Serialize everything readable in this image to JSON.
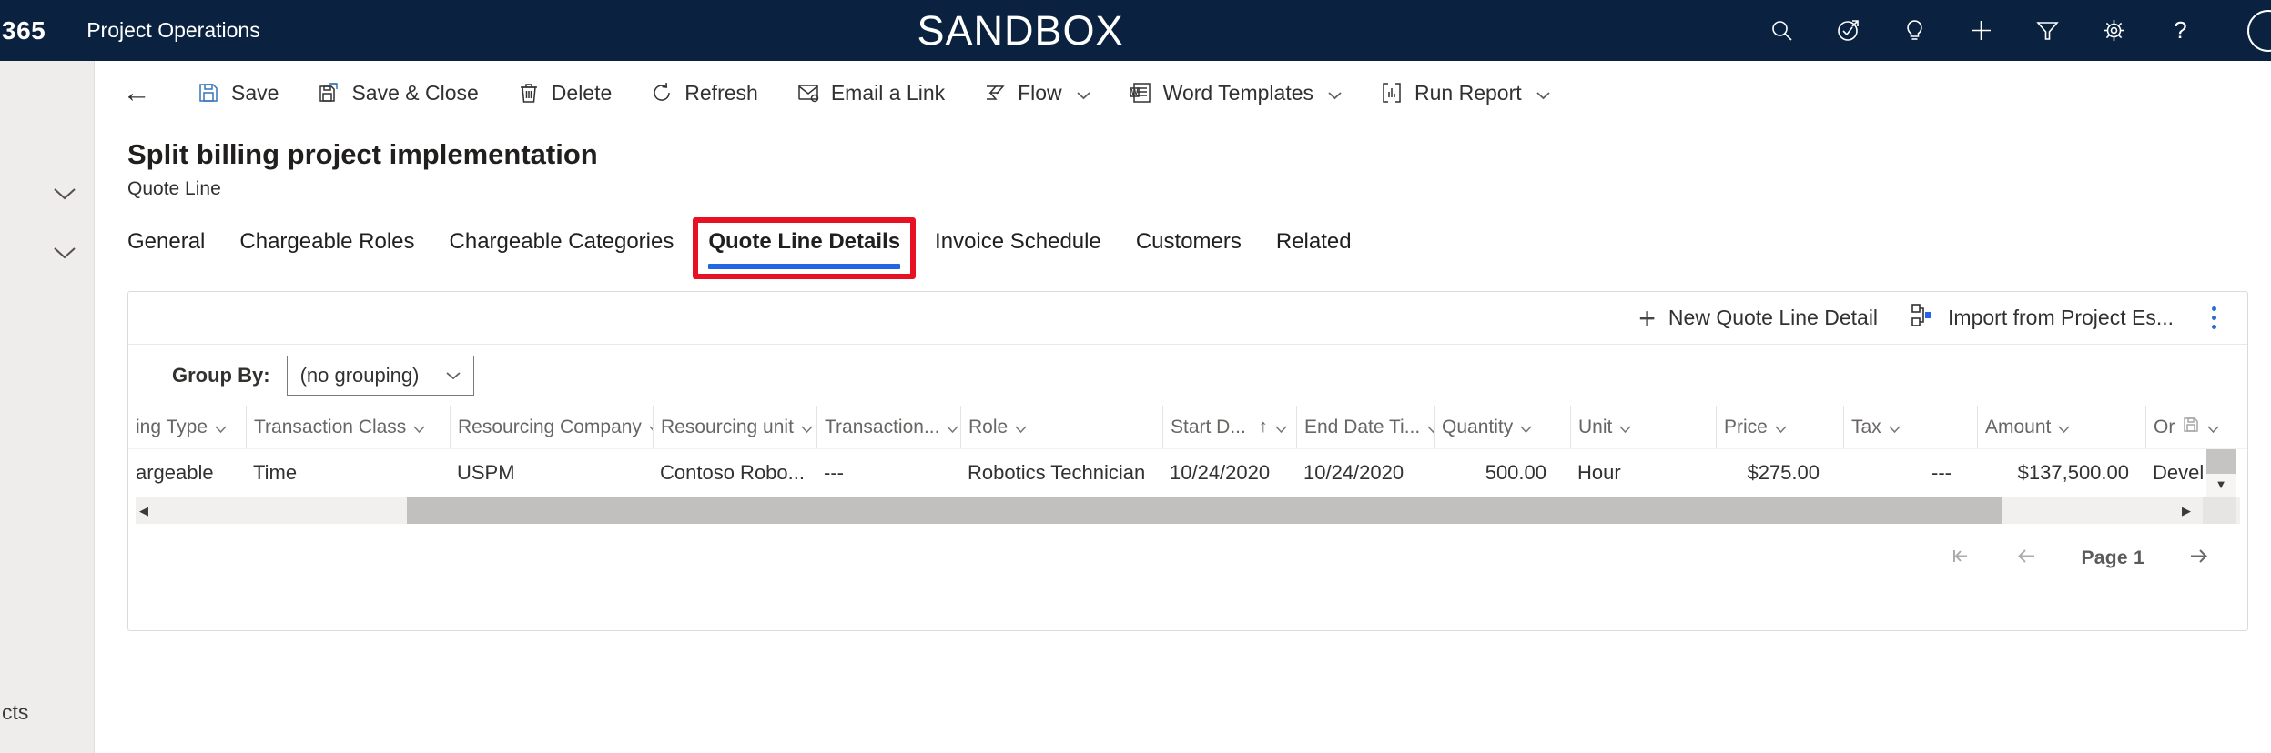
{
  "colors": {
    "topbar_bg": "#0A2240",
    "accent_blue": "#2266E3",
    "highlight_red": "#E81123"
  },
  "icons": {
    "back": "←",
    "sort_ascending": "↑",
    "scroll_left": "◀",
    "scroll_right": "▶",
    "scroll_down": "▼",
    "help": "?",
    "plus": "+"
  },
  "topbar": {
    "brand": "365",
    "app_name": "Project Operations",
    "environment": "SANDBOX"
  },
  "command_bar": {
    "items": [
      {
        "label": "Save"
      },
      {
        "label": "Save & Close"
      },
      {
        "label": "Delete"
      },
      {
        "label": "Refresh"
      },
      {
        "label": "Email a Link"
      },
      {
        "label": "Flow",
        "has_menu": true
      },
      {
        "label": "Word Templates",
        "has_menu": true
      },
      {
        "label": "Run Report",
        "has_menu": true
      }
    ]
  },
  "record_header": {
    "title": "Split billing project implementation",
    "subtitle": "Quote Line"
  },
  "tabs": [
    {
      "label": "General"
    },
    {
      "label": "Chargeable Roles"
    },
    {
      "label": "Chargeable Categories"
    },
    {
      "label": "Quote Line Details",
      "active": true
    },
    {
      "label": "Invoice Schedule"
    },
    {
      "label": "Customers"
    },
    {
      "label": "Related"
    }
  ],
  "grid": {
    "actions": {
      "new_label": "New Quote Line Detail",
      "import_label": "Import from Project Es..."
    },
    "group_by": {
      "label": "Group By:",
      "value": "(no grouping)"
    },
    "columns": [
      {
        "label": "ing Type"
      },
      {
        "label": "Transaction Class"
      },
      {
        "label": "Resourcing Company"
      },
      {
        "label": "Resourcing unit"
      },
      {
        "label": "Transaction..."
      },
      {
        "label": "Role"
      },
      {
        "label": "Start D...",
        "sorted": "asc"
      },
      {
        "label": "End Date Ti..."
      },
      {
        "label": "Quantity"
      },
      {
        "label": "Unit"
      },
      {
        "label": "Price"
      },
      {
        "label": "Tax"
      },
      {
        "label": "Amount"
      },
      {
        "label": "Or"
      }
    ],
    "rows": [
      {
        "cells": [
          "argeable",
          "Time",
          "USPM",
          "Contoso Robo...",
          "---",
          "Robotics Technician",
          "10/24/2020",
          "10/24/2020",
          "500.00",
          "Hour",
          "$275.00",
          "---",
          "$137,500.00",
          "Devel"
        ]
      }
    ],
    "pagination": {
      "page_label": "Page 1"
    }
  },
  "sidebar": {
    "bottom_text": "cts"
  }
}
